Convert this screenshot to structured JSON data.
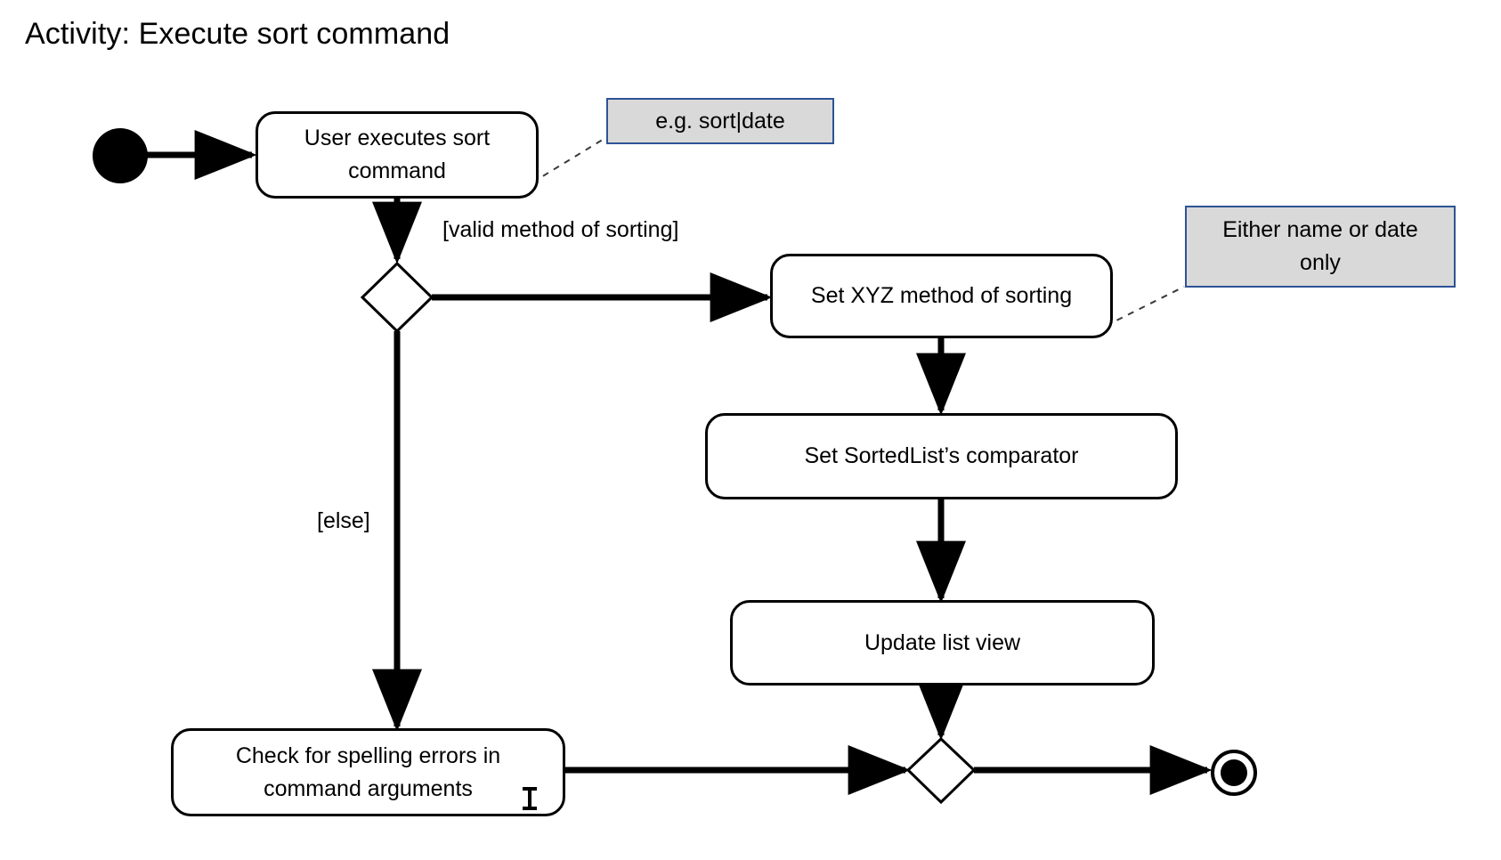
{
  "title": "Activity: Execute sort command",
  "colors": {
    "stroke": "#000000",
    "note_fill": "#d9d9d9",
    "note_border": "#2e5395",
    "canvas": "#ffffff"
  },
  "nodes": {
    "initial": {
      "name": "initial-node"
    },
    "action_user_executes": {
      "label": "User executes sort\ncommand"
    },
    "decision_valid": {
      "name": "decision-node"
    },
    "action_set_method": {
      "label": "Set XYZ method of sorting"
    },
    "action_set_comparator": {
      "label": "Set SortedList’s comparator"
    },
    "action_update_view": {
      "label": "Update list view"
    },
    "action_check_spelling": {
      "label": "Check for spelling errors in\ncommand arguments"
    },
    "merge": {
      "name": "merge-node"
    },
    "final": {
      "name": "final-node"
    }
  },
  "notes": [
    {
      "label": "e.g. sort|date"
    },
    {
      "label": "Either name or date\nonly"
    }
  ],
  "guards": [
    {
      "label": "[valid method of sorting]"
    },
    {
      "label": "[else]"
    }
  ],
  "artifacts": {
    "text_caret": "text-cursor-icon"
  }
}
